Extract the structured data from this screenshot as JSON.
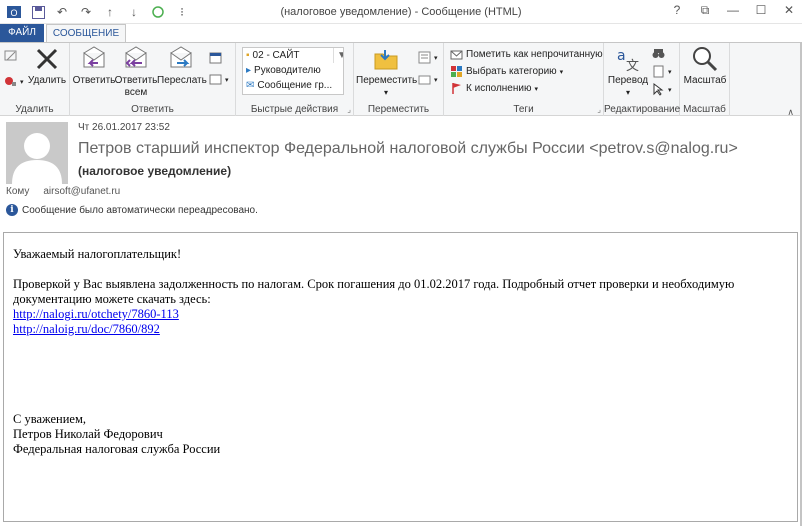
{
  "window": {
    "title": "(налоговое уведомление) - Сообщение (HTML)"
  },
  "qat": {
    "save_icon": "save-icon",
    "undo_icon": "undo-icon",
    "redo_icon": "redo-icon",
    "up_icon": "up-arrow-icon",
    "down_icon": "down-arrow-icon",
    "circle_icon": "circle-icon"
  },
  "window_controls": {
    "help": "?",
    "restore": "⧉",
    "minimize": "—",
    "maximize": "☐",
    "close": "✕"
  },
  "tabs": {
    "file": "ФАЙЛ",
    "message": "СООБЩЕНИЕ"
  },
  "ribbon": {
    "delete_group": {
      "label": "Удалить",
      "delete_label": "Удалить"
    },
    "respond_group": {
      "label": "Ответить",
      "reply": "Ответить",
      "reply_all_1": "Ответить",
      "reply_all_2": "всем",
      "forward": "Переслать"
    },
    "quick_steps": {
      "label": "Быстрые действия",
      "items": [
        "02 - САЙТ",
        "Руководителю",
        "Сообщение гр..."
      ]
    },
    "move_group": {
      "label": "Переместить",
      "move_1": "Переместить",
      "move_2": "▾"
    },
    "tags_group": {
      "label": "Теги",
      "mark_unread": "Пометить как непрочитанную",
      "categorize": "Выбрать категорию",
      "followup": "К исполнению"
    },
    "editing_group": {
      "label": "Редактирование",
      "translate_1": "Перевод",
      "translate_2": "▾"
    },
    "zoom_group": {
      "label": "Масштаб",
      "zoom": "Масштаб"
    },
    "colors": {
      "accent": "#2b579a",
      "flag": "#d13438"
    }
  },
  "message": {
    "date": "Чт 26.01.2017 23:52",
    "from": "Петров старший инспектор Федеральной налоговой службы России <petrov.s@nalog.ru>",
    "subject": "(налоговое уведомление)",
    "to_label": "Кому",
    "to_value": "airsoft@ufanet.ru",
    "info": "Сообщение было автоматически переадресовано."
  },
  "body": {
    "greeting": "Уважаемый налогоплательщик!",
    "para_1": "Проверкой у Вас выявлена задолженность по налогам. Срок погашения до 01.02.2017 года. Подробный отчет проверки и необходимую",
    "para_2": "документацию можете скачать здесь:",
    "link_1": "http://nalogi.ru/otchety/7860-113",
    "link_2": "http://naloig.ru/doc/7860/892",
    "closing": "С уважением,",
    "sign_name": "Петров Николай Федорович",
    "sign_org": "Федеральная налоговая служба России"
  }
}
